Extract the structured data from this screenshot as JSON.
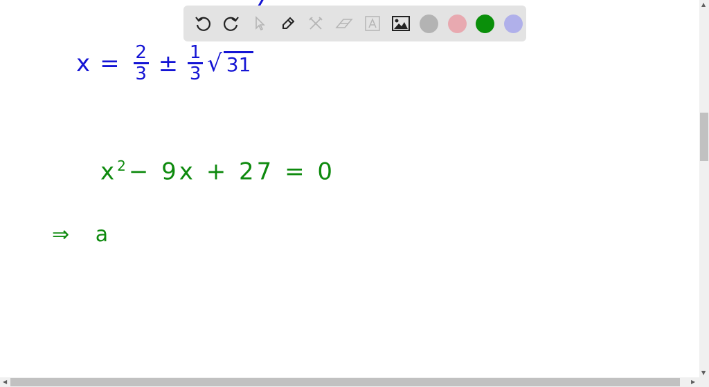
{
  "toolbar": {
    "tools": [
      {
        "name": "undo-icon",
        "glyph": "↶"
      },
      {
        "name": "redo-icon",
        "glyph": "↷"
      },
      {
        "name": "select-pointer-icon",
        "glyph": "➚"
      },
      {
        "name": "pen-icon",
        "glyph": "✎"
      },
      {
        "name": "tools-icon",
        "glyph": "✂"
      },
      {
        "name": "eraser-icon",
        "glyph": "▱"
      },
      {
        "name": "text-icon",
        "glyph": "A"
      },
      {
        "name": "image-icon",
        "glyph": "▣"
      }
    ],
    "colors": [
      "#b3b3b3",
      "#e8a9b0",
      "#0a8f0a",
      "#b0b0ea"
    ]
  },
  "work": {
    "line1": {
      "lhs": "x",
      "eq": "=",
      "f1_num": "2",
      "f1_den": "3",
      "pm": "±",
      "f2_num": "1",
      "f2_den": "3",
      "root": "√",
      "radicand": "31"
    },
    "line2": {
      "base": "x",
      "exp": "2",
      "rest": "− 9x + 27 = 0"
    },
    "line3": {
      "implies": "⇒",
      "text": "a"
    }
  },
  "colors": {
    "blue_ink": "#1414d4",
    "green_ink": "#0e8a0e"
  }
}
